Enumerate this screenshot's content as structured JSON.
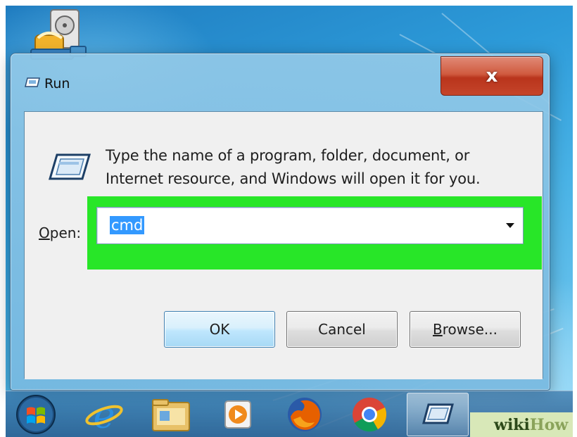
{
  "window": {
    "title": "Run",
    "close_glyph": "x"
  },
  "dialog": {
    "instruction_line1": "Type the name of a program, folder, document, or",
    "instruction_line2": "Internet resource, and Windows will open it for you.",
    "open_label_accel": "O",
    "open_label_rest": "pen:",
    "open_value": "cmd",
    "buttons": {
      "ok": "OK",
      "cancel": "Cancel",
      "browse_accel": "B",
      "browse_rest": "rowse..."
    }
  },
  "taskbar": {
    "items": [
      "start",
      "internet-explorer",
      "file-explorer",
      "media-player",
      "firefox",
      "chrome",
      "run"
    ]
  },
  "watermark": {
    "wiki": "wiki",
    "how": "How"
  },
  "colors": {
    "highlight": "#28e628",
    "selection": "#3399ff",
    "close_button": "#c5452a"
  }
}
